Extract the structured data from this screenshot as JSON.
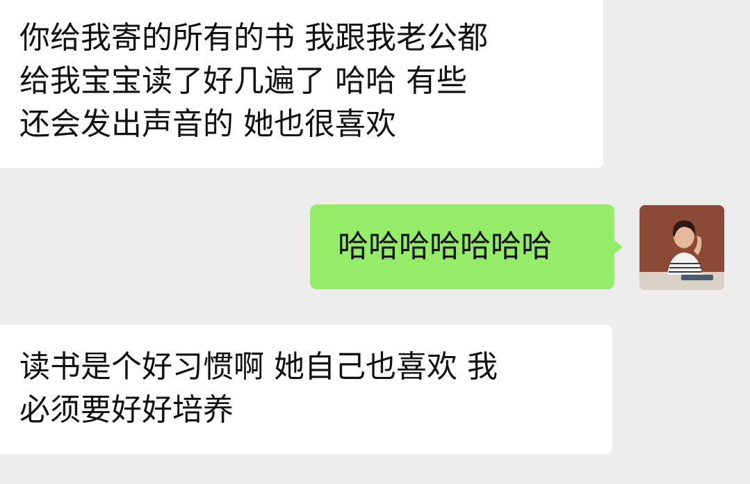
{
  "chat": {
    "messages": [
      {
        "sender": "other",
        "lines": [
          "你给我寄的所有的书  我跟我老公都",
          "给我宝宝读了好几遍了  哈哈  有些",
          "还会发出声音的  她也很喜欢"
        ]
      },
      {
        "sender": "self",
        "lines": [
          "哈哈哈哈哈哈哈"
        ]
      },
      {
        "sender": "other",
        "lines": [
          "读书是个好习惯啊 她自己也喜欢  我",
          "必须要好好培养"
        ]
      }
    ]
  },
  "avatar": {
    "icon": "user-avatar-photo",
    "colors": {
      "background": "#8a4a35",
      "desk": "#d8d1c7",
      "skin": "#e7b79a",
      "hair": "#2b1a14",
      "shirt": "#f2f2f2",
      "stripe": "#3a3a3a"
    }
  },
  "colors": {
    "background": "#ededed",
    "incoming_bubble": "#ffffff",
    "outgoing_bubble": "#95ec69",
    "text": "#111111"
  }
}
